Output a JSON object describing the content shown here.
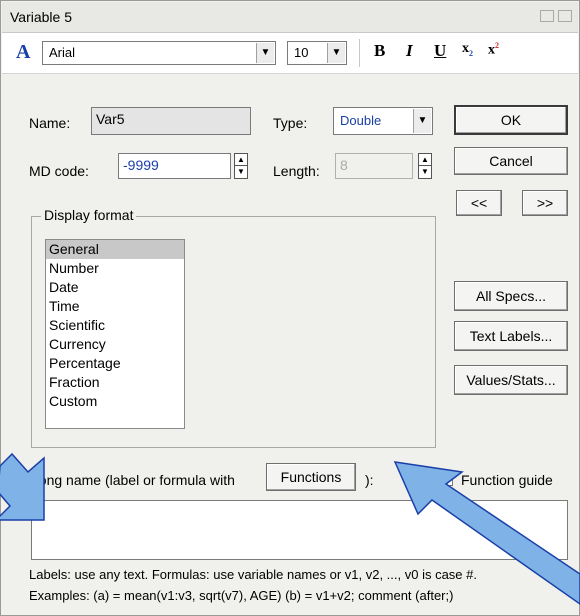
{
  "window": {
    "title": "Variable 5"
  },
  "toolbar": {
    "font_icon": "A",
    "font_name": "Arial",
    "font_size": "10",
    "bold": "B",
    "italic": "I",
    "underline": "U",
    "subscript": "x",
    "subscript_mark": "2",
    "superscript": "x",
    "superscript_mark": "2"
  },
  "form": {
    "name_label": "Name:",
    "name_value": "Var5",
    "type_label": "Type:",
    "type_value": "Double",
    "md_label": "MD code:",
    "md_value": "-9999",
    "length_label": "Length:",
    "length_value": "8"
  },
  "buttons": {
    "ok": "OK",
    "cancel": "Cancel",
    "prev": "<<",
    "next": ">>",
    "all_specs": "All Specs...",
    "text_labels": "Text Labels...",
    "values_stats": "Values/Stats...",
    "functions": "Functions"
  },
  "display_format": {
    "title": "Display format",
    "items": [
      "General",
      "Number",
      "Date",
      "Time",
      "Scientific",
      "Currency",
      "Percentage",
      "Fraction",
      "Custom"
    ],
    "selected": "General"
  },
  "long_name": {
    "label": "Long name (label or formula with",
    "label_end": "):",
    "function_guide": "Function guide",
    "value": ""
  },
  "help": {
    "line1": "Labels: use any text.  Formulas: use variable names or v1, v2, ..., v0 is case #.",
    "line2": "Examples:   (a) = mean(v1:v3, sqrt(v7), AGE)   (b) = v1+v2; comment (after;)"
  },
  "colors": {
    "accent_arrow": "#7fb2e6",
    "selection": "#c8c8c8",
    "type_text": "#1a3fa8"
  }
}
